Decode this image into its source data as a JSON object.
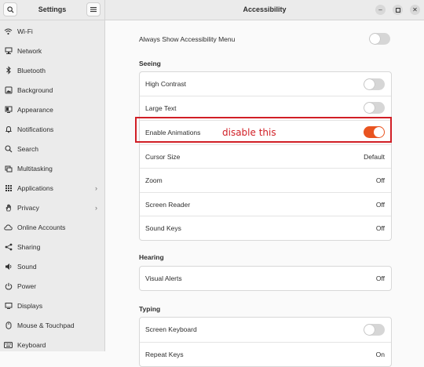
{
  "sidebar": {
    "title": "Settings",
    "items": [
      {
        "label": "Wi-Fi",
        "icon": "wifi-icon"
      },
      {
        "label": "Network",
        "icon": "network-icon"
      },
      {
        "label": "Bluetooth",
        "icon": "bluetooth-icon"
      },
      {
        "label": "Background",
        "icon": "background-icon"
      },
      {
        "label": "Appearance",
        "icon": "appearance-icon"
      },
      {
        "label": "Notifications",
        "icon": "bell-icon"
      },
      {
        "label": "Search",
        "icon": "search-icon"
      },
      {
        "label": "Multitasking",
        "icon": "multitasking-icon"
      },
      {
        "label": "Applications",
        "icon": "grid-icon",
        "chevron": true
      },
      {
        "label": "Privacy",
        "icon": "hand-icon",
        "chevron": true
      },
      {
        "label": "Online Accounts",
        "icon": "cloud-icon"
      },
      {
        "label": "Sharing",
        "icon": "share-icon"
      },
      {
        "label": "Sound",
        "icon": "speaker-icon"
      },
      {
        "label": "Power",
        "icon": "power-icon"
      },
      {
        "label": "Displays",
        "icon": "display-icon"
      },
      {
        "label": "Mouse & Touchpad",
        "icon": "mouse-icon"
      },
      {
        "label": "Keyboard",
        "icon": "keyboard-icon"
      }
    ]
  },
  "window": {
    "title": "Accessibility"
  },
  "top_setting": {
    "label": "Always Show Accessibility Menu",
    "switch_on": false
  },
  "sections": {
    "seeing": {
      "label": "Seeing",
      "rows": [
        {
          "label": "High Contrast",
          "type": "switch",
          "on": false
        },
        {
          "label": "Large Text",
          "type": "switch",
          "on": false
        },
        {
          "label": "Enable Animations",
          "type": "switch",
          "on": true
        },
        {
          "label": "Cursor Size",
          "type": "value",
          "value": "Default"
        },
        {
          "label": "Zoom",
          "type": "value",
          "value": "Off"
        },
        {
          "label": "Screen Reader",
          "type": "value",
          "value": "Off"
        },
        {
          "label": "Sound Keys",
          "type": "value",
          "value": "Off"
        }
      ]
    },
    "hearing": {
      "label": "Hearing",
      "rows": [
        {
          "label": "Visual Alerts",
          "type": "value",
          "value": "Off"
        }
      ]
    },
    "typing": {
      "label": "Typing",
      "rows": [
        {
          "label": "Screen Keyboard",
          "type": "switch",
          "on": false
        },
        {
          "label": "Repeat Keys",
          "type": "value",
          "value": "On"
        }
      ]
    }
  },
  "annotation": {
    "text": "disable this",
    "color": "#d11f26"
  },
  "colors": {
    "accent": "#e95420"
  }
}
